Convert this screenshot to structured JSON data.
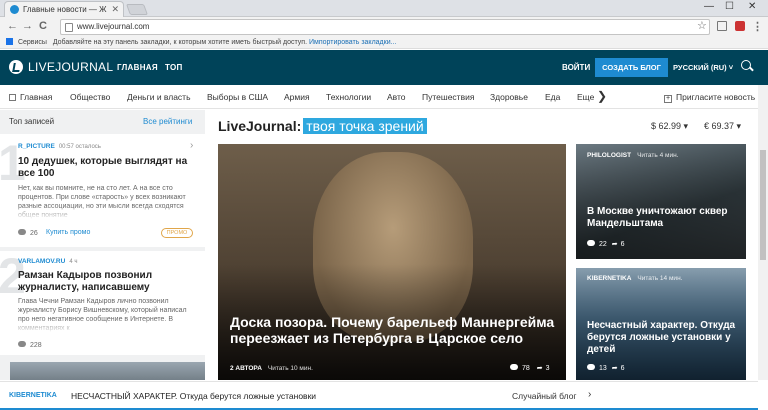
{
  "browser": {
    "tab_title": "Главные новости — Ж",
    "tab_close": "✕",
    "url": "www.livejournal.com",
    "bookmarks_apps": "Сервисы",
    "bookmarks_text": "Добавляйте на эту панель закладки, к которым хотите иметь быстрый доступ.",
    "bookmarks_import": "Импортировать закладки...",
    "win_min": "—",
    "win_max": "☐",
    "win_close": "✕",
    "back": "←",
    "forward": "→",
    "reload": "C",
    "star": "☆",
    "menu": "⋮"
  },
  "header": {
    "brand": "LIVEJOURNAL",
    "nav": [
      "ГЛАВНАЯ",
      "ТОП"
    ],
    "login": "ВОЙТИ",
    "create_blog": "СОЗДАТЬ БЛОГ",
    "language": "РУССКИЙ (RU) ˅"
  },
  "categories": [
    "Главная",
    "Общество",
    "Деньги и власть",
    "Выборы в США",
    "Армия",
    "Технологии",
    "Авто",
    "Путешествия",
    "Здоровье",
    "Еда",
    "Еще"
  ],
  "category_more_arrow": "❯",
  "invite": "Пригласите новость",
  "invite_plus": "+",
  "sidebar": {
    "heading": "Топ записей",
    "all_ratings": "Все рейтинги",
    "items": [
      {
        "rank": "1",
        "author": "R_PICTURE",
        "time": "00:57 осталось",
        "title": "10 дедушек, которые выглядят на все 100",
        "excerpt": "Нет, как вы помните, не на сто лет. А на все сто процентов. При слове «старость» у всех возникают разные ассоциации, но эти мысли всегда сходятся общее понятие",
        "comments": "26",
        "buy": "Купить промо",
        "promo": "ПРОМО",
        "chevron": "›"
      },
      {
        "rank": "2",
        "author": "VARLAMOV.RU",
        "time": "4 ч",
        "title": "Рамзан Кадыров позвонил журналисту, написавшему",
        "excerpt": "Глава Чечни Рамзан Кадыров лично позвонил журналисту Борису Вишневскому, который написал про него негативное сообщение в Интернете. В комментариях к",
        "comments": "228"
      }
    ]
  },
  "main": {
    "title_prefix": "LiveJournal:",
    "title_highlight": "твоя точка зрений",
    "usd": "$ 62.99 ▾",
    "eur": "€ 69.37 ▾"
  },
  "hero": {
    "title": "Доска позора. Почему барельеф Маннергейма переезжает из Петербурга в Царское село",
    "author": "2 АВТОРА",
    "read_time": "Читать 10 мин.",
    "comments": "78",
    "shares": "3"
  },
  "cards": [
    {
      "author": "PHILOLOGIST",
      "read_time": "Читать 4 мин.",
      "title": "В Москве уничтожают сквер Мандельштама",
      "comments": "22",
      "shares": "6"
    },
    {
      "author": "KIBERNETIKA",
      "read_time": "Читать 14 мин.",
      "title": "Несчастный характер. Откуда берутся ложные установки у детей",
      "comments": "13",
      "shares": "6"
    }
  ],
  "ticker": {
    "author": "KIBERNETIKA",
    "title": "НЕСЧАСТНЫЙ ХАРАКТЕР. Откуда берутся ложные установки",
    "random": "Случайный блог",
    "arrow": "›"
  },
  "colors": {
    "header_bg": "#004359",
    "accent": "#1e8bd1",
    "highlight": "#2ea8df",
    "promo": "#e0a64a"
  }
}
